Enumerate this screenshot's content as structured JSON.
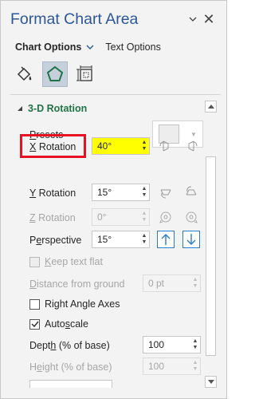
{
  "header": {
    "title": "Format Chart Area",
    "dropdown_icon": "chevron-down-icon",
    "close_icon": "close-icon",
    "close_glyph": "✕"
  },
  "tabs": {
    "active": "Chart Options",
    "other": "Text Options"
  },
  "icon_tabs": [
    "fill-line-icon",
    "effects-icon",
    "size-properties-icon"
  ],
  "section": {
    "title": "3-D Rotation"
  },
  "presets": {
    "label_u": "P",
    "label_rest": "resets"
  },
  "x_rotation": {
    "label_u": "X",
    "label_rest": " Rotation",
    "value": "40°"
  },
  "y_rotation": {
    "label_u": "Y",
    "label_rest": " Rotation",
    "value": "15°"
  },
  "z_rotation": {
    "label_u": "Z",
    "label_rest": " Rotation",
    "value": "0°"
  },
  "perspective": {
    "label_pre": "P",
    "label_u": "e",
    "label_rest": "rspective",
    "value": "15°"
  },
  "keep_text_flat": {
    "label_u": "K",
    "label_rest": "eep text flat",
    "checked": false,
    "disabled": true
  },
  "distance": {
    "label_u": "D",
    "label_rest": "istance from ground",
    "value": "0 pt"
  },
  "right_angle": {
    "label": "Right Angle Axes",
    "checked": false
  },
  "autoscale": {
    "label_pre": "Auto",
    "label_u": "s",
    "label_rest": "cale",
    "checked": true
  },
  "depth": {
    "label_pre": "Dept",
    "label_u": "h",
    "label_rest": " (% of base)",
    "value": "100"
  },
  "height": {
    "label_pre": "H",
    "label_u": "e",
    "label_rest": "ight (% of base)",
    "value": "100"
  },
  "colors": {
    "title_blue": "#2b579a",
    "section_green": "#217346",
    "highlight_yellow": "#ffff00",
    "annotation_red": "#e81123",
    "accent_blue": "#2b7cd3"
  }
}
